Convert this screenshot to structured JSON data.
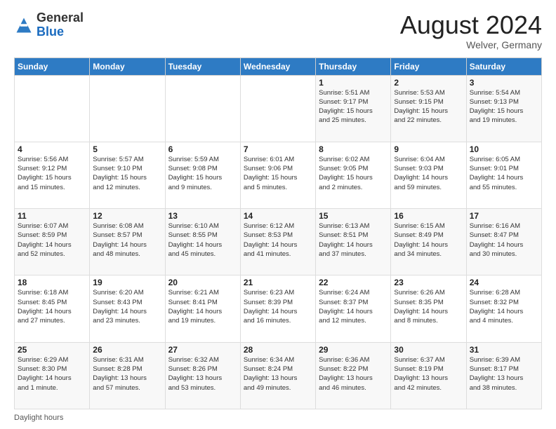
{
  "header": {
    "logo_general": "General",
    "logo_blue": "Blue",
    "month_title": "August 2024",
    "location": "Welver, Germany"
  },
  "footer": {
    "label": "Daylight hours"
  },
  "weekdays": [
    "Sunday",
    "Monday",
    "Tuesday",
    "Wednesday",
    "Thursday",
    "Friday",
    "Saturday"
  ],
  "weeks": [
    [
      {
        "day": "",
        "info": ""
      },
      {
        "day": "",
        "info": ""
      },
      {
        "day": "",
        "info": ""
      },
      {
        "day": "",
        "info": ""
      },
      {
        "day": "1",
        "info": "Sunrise: 5:51 AM\nSunset: 9:17 PM\nDaylight: 15 hours\nand 25 minutes."
      },
      {
        "day": "2",
        "info": "Sunrise: 5:53 AM\nSunset: 9:15 PM\nDaylight: 15 hours\nand 22 minutes."
      },
      {
        "day": "3",
        "info": "Sunrise: 5:54 AM\nSunset: 9:13 PM\nDaylight: 15 hours\nand 19 minutes."
      }
    ],
    [
      {
        "day": "4",
        "info": "Sunrise: 5:56 AM\nSunset: 9:12 PM\nDaylight: 15 hours\nand 15 minutes."
      },
      {
        "day": "5",
        "info": "Sunrise: 5:57 AM\nSunset: 9:10 PM\nDaylight: 15 hours\nand 12 minutes."
      },
      {
        "day": "6",
        "info": "Sunrise: 5:59 AM\nSunset: 9:08 PM\nDaylight: 15 hours\nand 9 minutes."
      },
      {
        "day": "7",
        "info": "Sunrise: 6:01 AM\nSunset: 9:06 PM\nDaylight: 15 hours\nand 5 minutes."
      },
      {
        "day": "8",
        "info": "Sunrise: 6:02 AM\nSunset: 9:05 PM\nDaylight: 15 hours\nand 2 minutes."
      },
      {
        "day": "9",
        "info": "Sunrise: 6:04 AM\nSunset: 9:03 PM\nDaylight: 14 hours\nand 59 minutes."
      },
      {
        "day": "10",
        "info": "Sunrise: 6:05 AM\nSunset: 9:01 PM\nDaylight: 14 hours\nand 55 minutes."
      }
    ],
    [
      {
        "day": "11",
        "info": "Sunrise: 6:07 AM\nSunset: 8:59 PM\nDaylight: 14 hours\nand 52 minutes."
      },
      {
        "day": "12",
        "info": "Sunrise: 6:08 AM\nSunset: 8:57 PM\nDaylight: 14 hours\nand 48 minutes."
      },
      {
        "day": "13",
        "info": "Sunrise: 6:10 AM\nSunset: 8:55 PM\nDaylight: 14 hours\nand 45 minutes."
      },
      {
        "day": "14",
        "info": "Sunrise: 6:12 AM\nSunset: 8:53 PM\nDaylight: 14 hours\nand 41 minutes."
      },
      {
        "day": "15",
        "info": "Sunrise: 6:13 AM\nSunset: 8:51 PM\nDaylight: 14 hours\nand 37 minutes."
      },
      {
        "day": "16",
        "info": "Sunrise: 6:15 AM\nSunset: 8:49 PM\nDaylight: 14 hours\nand 34 minutes."
      },
      {
        "day": "17",
        "info": "Sunrise: 6:16 AM\nSunset: 8:47 PM\nDaylight: 14 hours\nand 30 minutes."
      }
    ],
    [
      {
        "day": "18",
        "info": "Sunrise: 6:18 AM\nSunset: 8:45 PM\nDaylight: 14 hours\nand 27 minutes."
      },
      {
        "day": "19",
        "info": "Sunrise: 6:20 AM\nSunset: 8:43 PM\nDaylight: 14 hours\nand 23 minutes."
      },
      {
        "day": "20",
        "info": "Sunrise: 6:21 AM\nSunset: 8:41 PM\nDaylight: 14 hours\nand 19 minutes."
      },
      {
        "day": "21",
        "info": "Sunrise: 6:23 AM\nSunset: 8:39 PM\nDaylight: 14 hours\nand 16 minutes."
      },
      {
        "day": "22",
        "info": "Sunrise: 6:24 AM\nSunset: 8:37 PM\nDaylight: 14 hours\nand 12 minutes."
      },
      {
        "day": "23",
        "info": "Sunrise: 6:26 AM\nSunset: 8:35 PM\nDaylight: 14 hours\nand 8 minutes."
      },
      {
        "day": "24",
        "info": "Sunrise: 6:28 AM\nSunset: 8:32 PM\nDaylight: 14 hours\nand 4 minutes."
      }
    ],
    [
      {
        "day": "25",
        "info": "Sunrise: 6:29 AM\nSunset: 8:30 PM\nDaylight: 14 hours\nand 1 minute."
      },
      {
        "day": "26",
        "info": "Sunrise: 6:31 AM\nSunset: 8:28 PM\nDaylight: 13 hours\nand 57 minutes."
      },
      {
        "day": "27",
        "info": "Sunrise: 6:32 AM\nSunset: 8:26 PM\nDaylight: 13 hours\nand 53 minutes."
      },
      {
        "day": "28",
        "info": "Sunrise: 6:34 AM\nSunset: 8:24 PM\nDaylight: 13 hours\nand 49 minutes."
      },
      {
        "day": "29",
        "info": "Sunrise: 6:36 AM\nSunset: 8:22 PM\nDaylight: 13 hours\nand 46 minutes."
      },
      {
        "day": "30",
        "info": "Sunrise: 6:37 AM\nSunset: 8:19 PM\nDaylight: 13 hours\nand 42 minutes."
      },
      {
        "day": "31",
        "info": "Sunrise: 6:39 AM\nSunset: 8:17 PM\nDaylight: 13 hours\nand 38 minutes."
      }
    ]
  ]
}
